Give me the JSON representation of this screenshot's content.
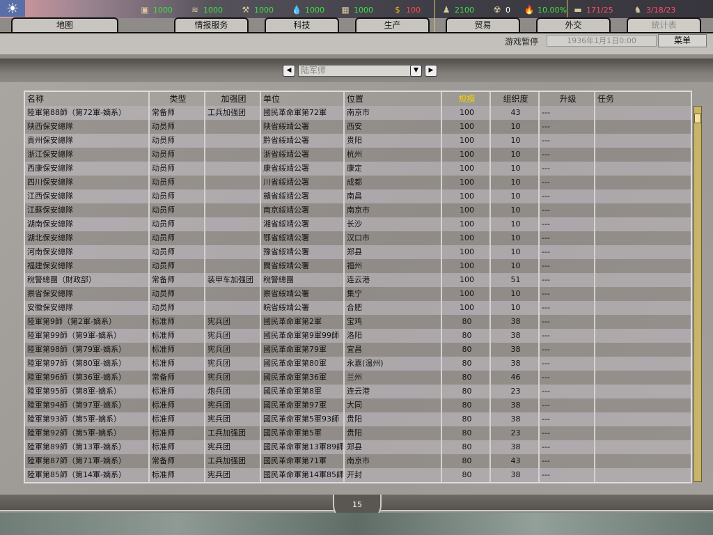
{
  "resources": [
    {
      "icon": "energy-icon",
      "value": "1000",
      "color": "#3fe03f"
    },
    {
      "icon": "metal-icon",
      "value": "1000",
      "color": "#3fe03f"
    },
    {
      "icon": "rare-materials-icon",
      "value": "1000",
      "color": "#3fe03f"
    },
    {
      "icon": "oil-icon",
      "value": "1000",
      "color": "#3fe03f"
    },
    {
      "icon": "supplies-icon",
      "value": "1000",
      "color": "#3fe03f"
    },
    {
      "icon": "money-icon",
      "value": "100",
      "color": "#ff4c4c"
    },
    {
      "icon": "manpower-icon",
      "value": "2100",
      "color": "#3fe03f"
    },
    {
      "icon": "nuclear-icon",
      "value": "0",
      "color": "#ffffff"
    },
    {
      "icon": "dissent-icon",
      "value": "10.00%",
      "color": "#3fe03f"
    },
    {
      "icon": "transport-icon",
      "value": "171/25",
      "color": "#ff4c6a"
    },
    {
      "icon": "officers-icon",
      "value": "3/18/23",
      "color": "#ff4c6a"
    }
  ],
  "tabs": [
    "地图",
    "情报服务",
    "科技",
    "生产",
    "贸易",
    "外交",
    "统计表"
  ],
  "status": {
    "paused": "游戏暂停",
    "date": "1936年1月1日0:00",
    "menu": "菜单"
  },
  "filter": {
    "selected": "陆军师"
  },
  "columns": [
    "名称",
    "类型",
    "加强团",
    "单位",
    "位置",
    "规模",
    "组织度",
    "升级",
    "任务"
  ],
  "rows": [
    [
      "陸軍第88師（第72軍-嫡系）",
      "常备师",
      "工兵加强团",
      "國民革命軍第72軍",
      "南京市",
      "100",
      "43",
      "---",
      ""
    ],
    [
      "陕西保安總隊",
      "动员师",
      "",
      "陕省綏靖公署",
      "西安",
      "100",
      "10",
      "---",
      ""
    ],
    [
      "貴州保安總隊",
      "动员师",
      "",
      "黔省綏靖公署",
      "贵阳",
      "100",
      "10",
      "---",
      ""
    ],
    [
      "浙江保安總隊",
      "动员师",
      "",
      "浙省綏靖公署",
      "杭州",
      "100",
      "10",
      "---",
      ""
    ],
    [
      "西康保安總隊",
      "动员师",
      "",
      "康省綏靖公署",
      "康定",
      "100",
      "10",
      "---",
      ""
    ],
    [
      "四川保安總隊",
      "动员师",
      "",
      "川省綏靖公署",
      "成都",
      "100",
      "10",
      "---",
      ""
    ],
    [
      "江西保安總隊",
      "动员师",
      "",
      "贛省綏靖公署",
      "南昌",
      "100",
      "10",
      "---",
      ""
    ],
    [
      "江蘇保安總隊",
      "动员师",
      "",
      "南京綏靖公署",
      "南京市",
      "100",
      "10",
      "---",
      ""
    ],
    [
      "湖南保安總隊",
      "动员师",
      "",
      "湘省綏靖公署",
      "长沙",
      "100",
      "10",
      "---",
      ""
    ],
    [
      "湖北保安總隊",
      "动员师",
      "",
      "鄂省綏靖公署",
      "汉口市",
      "100",
      "10",
      "---",
      ""
    ],
    [
      "河南保安總隊",
      "动员师",
      "",
      "豫省綏靖公署",
      "郑县",
      "100",
      "10",
      "---",
      ""
    ],
    [
      "福建保安總隊",
      "动员师",
      "",
      "閩省綏靖公署",
      "福州",
      "100",
      "10",
      "---",
      ""
    ],
    [
      "稅警總團（財政部）",
      "常备师",
      "装甲车加强团",
      "稅警總團",
      "连云港",
      "100",
      "51",
      "---",
      ""
    ],
    [
      "察省保安總隊",
      "动员师",
      "",
      "察省綏靖公署",
      "集宁",
      "100",
      "10",
      "---",
      ""
    ],
    [
      "安徽保安總隊",
      "动员师",
      "",
      "皖省綏靖公署",
      "合肥",
      "100",
      "10",
      "---",
      ""
    ],
    [
      "陸軍第9師（第2軍-嫡系）",
      "标准师",
      "宪兵团",
      "國民革命軍第2軍",
      "宝鸡",
      "80",
      "38",
      "---",
      ""
    ],
    [
      "陸軍第99師（第9軍-嫡系）",
      "标准师",
      "宪兵团",
      "國民革命軍第9軍99師",
      "洛阳",
      "80",
      "38",
      "---",
      ""
    ],
    [
      "陸軍第98師（第79軍-嫡系）",
      "标准师",
      "宪兵团",
      "國民革命軍第79軍",
      "宜昌",
      "80",
      "38",
      "---",
      ""
    ],
    [
      "陸軍第97師（第80軍-嫡系）",
      "标准师",
      "宪兵团",
      "國民革命軍第80軍",
      "永嘉(温州)",
      "80",
      "38",
      "---",
      ""
    ],
    [
      "陸軍第96師（第36軍-嫡系）",
      "常备师",
      "宪兵团",
      "國民革命軍第36軍",
      "兰州",
      "80",
      "46",
      "---",
      ""
    ],
    [
      "陸軍第95師（第8軍-嫡系）",
      "标准师",
      "炮兵团",
      "國民革命軍第8軍",
      "连云港",
      "80",
      "23",
      "---",
      ""
    ],
    [
      "陸軍第94師（第97軍-嫡系）",
      "标准师",
      "宪兵团",
      "國民革命軍第97軍",
      "大同",
      "80",
      "38",
      "---",
      ""
    ],
    [
      "陸軍第93師（第5軍-嫡系）",
      "标准师",
      "宪兵团",
      "國民革命軍第5軍93師",
      "贵阳",
      "80",
      "38",
      "---",
      ""
    ],
    [
      "陸軍第92師（第5軍-嫡系）",
      "标准师",
      "工兵加强团",
      "國民革命軍第5軍",
      "贵阳",
      "80",
      "23",
      "---",
      ""
    ],
    [
      "陸軍第89師（第13軍-嫡系）",
      "标准师",
      "宪兵团",
      "國民革命軍第13軍89師",
      "郑县",
      "80",
      "38",
      "---",
      ""
    ],
    [
      "陸軍第87師（第71軍-嫡系）",
      "常备师",
      "工兵加强团",
      "國民革命軍第71軍",
      "南京市",
      "80",
      "43",
      "---",
      ""
    ],
    [
      "陸軍第85師（第14軍-嫡系）",
      "标准师",
      "宪兵团",
      "國民革命軍第14軍85師",
      "开封",
      "80",
      "38",
      "---",
      ""
    ]
  ],
  "footer": {
    "count": "15"
  }
}
